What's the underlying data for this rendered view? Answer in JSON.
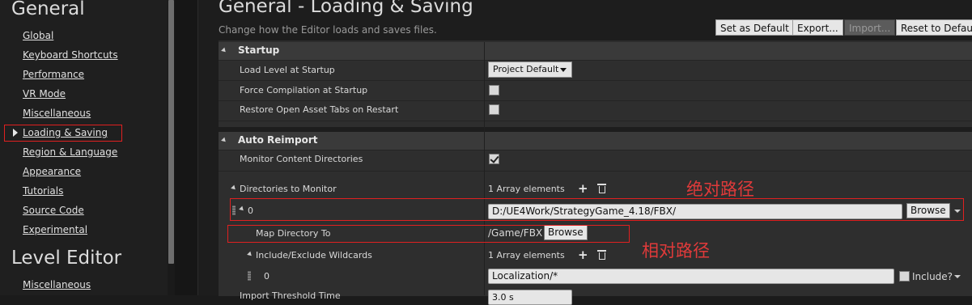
{
  "sidebar": {
    "general_title": "General",
    "items": [
      {
        "label": "Global"
      },
      {
        "label": "Keyboard Shortcuts"
      },
      {
        "label": "Performance"
      },
      {
        "label": "VR Mode"
      },
      {
        "label": "Miscellaneous"
      },
      {
        "label": "Loading & Saving",
        "selected": true
      },
      {
        "label": "Region & Language"
      },
      {
        "label": "Appearance"
      },
      {
        "label": "Tutorials"
      },
      {
        "label": "Source Code"
      },
      {
        "label": "Experimental"
      }
    ],
    "level_editor_title": "Level Editor",
    "level_editor_items": [
      {
        "label": "Miscellaneous"
      }
    ]
  },
  "header": {
    "title": "General - Loading & Saving",
    "subtitle": "Change how the Editor loads and saves files.",
    "buttons": {
      "set_default": "Set as Default",
      "export": "Export...",
      "import": "Import...",
      "reset": "Reset to Defaults"
    }
  },
  "startup": {
    "title": "Startup",
    "load_level_label": "Load Level at Startup",
    "load_level_value": "Project Default",
    "force_compile_label": "Force Compilation at Startup",
    "force_compile_checked": false,
    "restore_tabs_label": "Restore Open Asset Tabs on Restart",
    "restore_tabs_checked": false
  },
  "auto_reimport": {
    "title": "Auto Reimport",
    "monitor_label": "Monitor Content Directories",
    "monitor_checked": true,
    "dirs_label": "Directories to Monitor",
    "dirs_count": "1 Array elements",
    "element_index": "0",
    "path_value": "D:/UE4Work/StrategyGame_4.18/FBX/",
    "browse_label": "Browse",
    "map_label": "Map Directory To",
    "map_value": "/Game/FBX",
    "wildcards_label": "Include/Exclude Wildcards",
    "wildcards_count": "1 Array elements",
    "wildcard_index": "0",
    "wildcard_value": "Localization/*",
    "include_label": "Include?",
    "threshold_label": "Import Threshold Time",
    "threshold_value": "3.0 s"
  },
  "annotations": {
    "absolute_path": "绝对路径",
    "relative_path": "相对路径"
  },
  "colors": {
    "highlight_red": "#e02020",
    "note_red": "#e03a3a"
  }
}
